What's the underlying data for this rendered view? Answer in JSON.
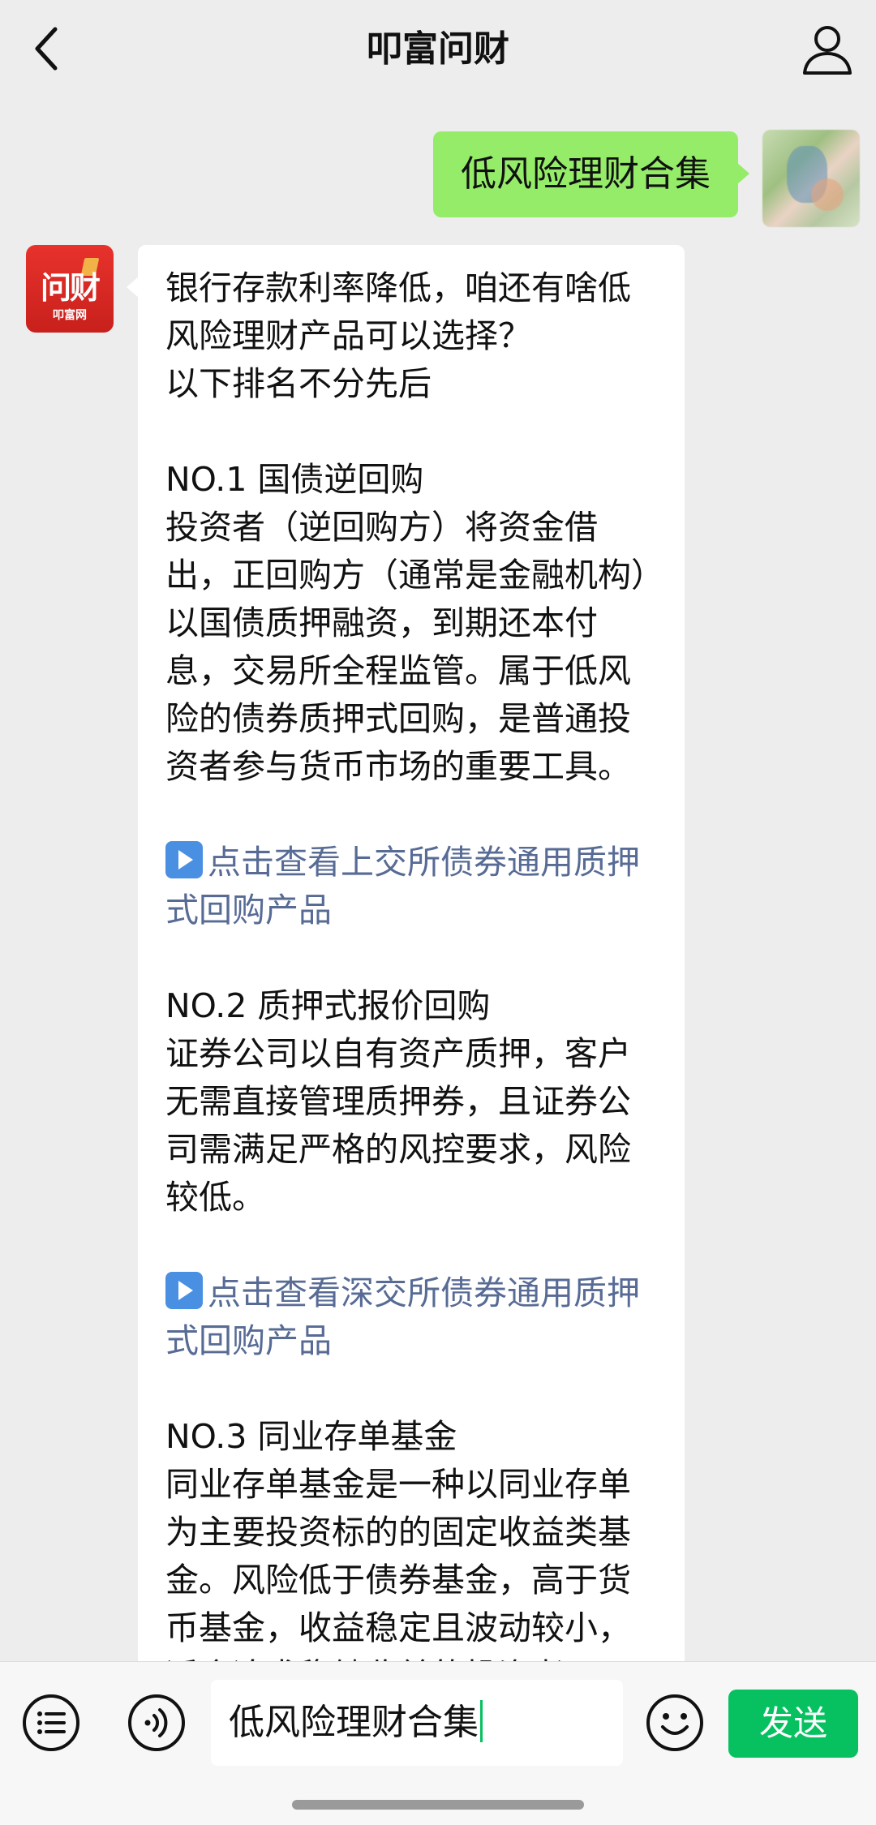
{
  "header": {
    "title": "叩富问财",
    "back_icon": "chevron-left-icon",
    "profile_icon": "user-icon"
  },
  "messages": {
    "outgoing": {
      "text": "低风险理财合集"
    },
    "incoming": {
      "avatar_logo": "问财",
      "avatar_sub": "叩富网",
      "intro": "银行存款利率降低，咱还有啥低风险理财产品可以选择？\n以下排名不分先后",
      "item1_title": "NO.1 国债逆回购",
      "item1_body": "投资者（逆回购方）将资金借出，正回购方（通常是金融机构）以国债质押融资，到期还本付息，交易所全程监管。属于低风险的债券质押式回购，是普通投资者参与货币市场的重要工具。",
      "link1": "点击查看上交所债券通用质押式回购产品",
      "item2_title": "NO.2 质押式报价回购",
      "item2_body": "证券公司以自有资产质押，客户无需直接管理质押券，且证券公司需满足严格的风控要求，风险较低。",
      "link2": "点击查看深交所债券通用质押式回购产品",
      "item3_title": "NO.3 同业存单基金",
      "item3_body": "同业存单基金是一种以同业存单为主要投资标的的固定收益类基金。风险低于债券基金，高于货币基金，收益稳定且波动较小，适合追求稳健收益的投资者。"
    }
  },
  "input_bar": {
    "menu_icon": "list-menu-icon",
    "voice_icon": "voice-icon",
    "input_value": "低风险理财合集",
    "emoji_icon": "emoji-icon",
    "send_label": "发送"
  },
  "colors": {
    "background": "#ededed",
    "outgoing_bubble": "#95ec69",
    "link": "#576b95",
    "send_button": "#07c160",
    "bot_avatar": "#e8322c"
  }
}
